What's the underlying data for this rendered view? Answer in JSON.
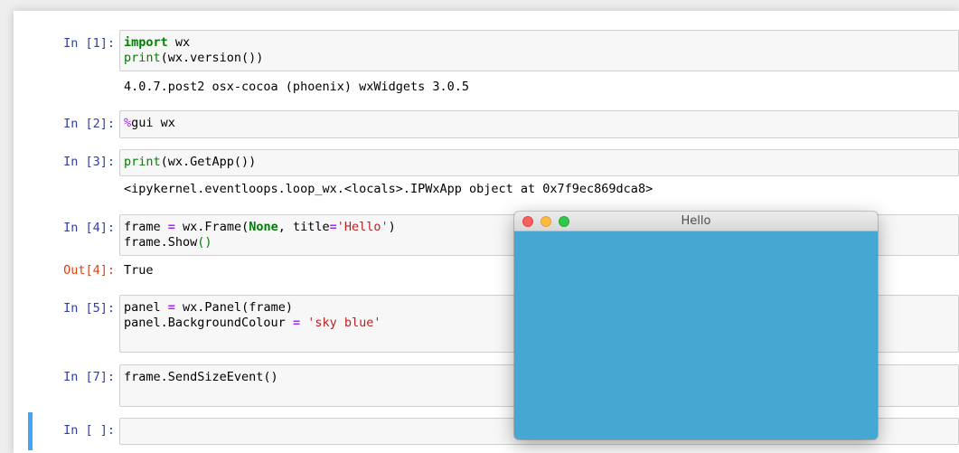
{
  "cells": {
    "c1": {
      "prompt": "In [1]:",
      "output": "4.0.7.post2 osx-cocoa (phoenix) wxWidgets 3.0.5"
    },
    "c2": {
      "prompt": "In [2]:"
    },
    "c3": {
      "prompt": "In [3]:",
      "output": "<ipykernel.eventloops.loop_wx.<locals>.IPWxApp object at 0x7f9ec869dca8>"
    },
    "c4": {
      "prompt": "In [4]:",
      "out_prompt": "Out[4]:",
      "output": "True"
    },
    "c5": {
      "prompt": "In [5]:"
    },
    "c7": {
      "prompt": "In [7]:"
    },
    "empty": {
      "prompt": "In [ ]:",
      "code": ""
    }
  },
  "wx_window": {
    "title": "Hello",
    "panel_color": "#45a8d3"
  },
  "colors": {
    "keyword": "#008000",
    "operator": "#aa22ff",
    "string": "#ba2121",
    "in_prompt": "#303f9f",
    "out_prompt": "#d84315",
    "selected_cell_bar": "#42a5f5"
  }
}
